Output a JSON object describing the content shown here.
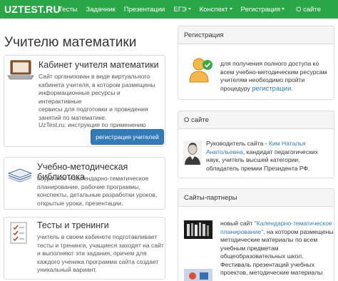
{
  "navbar": {
    "brand": "UZTEST.RU",
    "items": [
      "Тесты",
      "Задачник",
      "Презентации",
      "ЕГЭ",
      "Конспект",
      "Регистрация",
      "О сайте"
    ]
  },
  "page_title": "Учителю математики",
  "cards": {
    "cabinet": {
      "title": "Кабинет учителя математики",
      "lines": [
        "Сайт организован в виде виртуального",
        "кабинета учителя, в котором размещены",
        "информационные ресурсы и интерактивные",
        "сервисы для подготовки и проведения",
        "занятий по математике."
      ],
      "link": "UzTest.ru: инструкция по применению",
      "button": "регистрация учителей"
    },
    "library": {
      "title": "Учебно-методическая библиотека",
      "lines": [
        "поурочное и календарно-тематическое",
        "планирование, рабочие программы,",
        "конспекты, детальные разработки уроков,",
        "открытые уроки, презентации."
      ]
    },
    "tests": {
      "title": "Тесты и тренинги",
      "lines": [
        "учитель в своем кабинете подготавливает",
        "тесты и тренинги, учащиеся заходят на сайт",
        "и выполняют эти задания, причем для",
        "каждого ученика программа сайта создает",
        "уникальный вариант."
      ]
    }
  },
  "panels": {
    "registration": {
      "header": "Регистрация",
      "lines": [
        "для получения полного доступа ко",
        "всем учебно-методическим ресурсам",
        "учителям необходимо пройти"
      ],
      "last_prefix": "процедуру ",
      "last_link": "регистрации."
    },
    "about": {
      "header": "О сайте",
      "prefix": "Руководитель сайта - ",
      "name_part1": "Ким Наталья",
      "name_part2": "Анатольевна",
      "line1_suffix": ", кандидат педагогических",
      "lines": [
        "наук, учитель высшей категории,",
        "обладатель премии Президента РФ."
      ]
    },
    "partners": {
      "header": "Сайты-партнеры",
      "p1_prefix": "новый сайт ",
      "p1_link_lines": [
        "\"Календарно-тематическое",
        "планирование\""
      ],
      "p1_after_link": ", на котором размещены",
      "p1_lines": [
        "методические материалы по всем",
        "учебным предметам",
        "общеобразовательных школ."
      ],
      "p2_lines": [
        "Фестиваль презентаций учебных",
        "проектов, методические материалы"
      ]
    }
  },
  "colors": {
    "navbar": "#29a645",
    "button": "#337ab7",
    "link": "#337ab7"
  }
}
